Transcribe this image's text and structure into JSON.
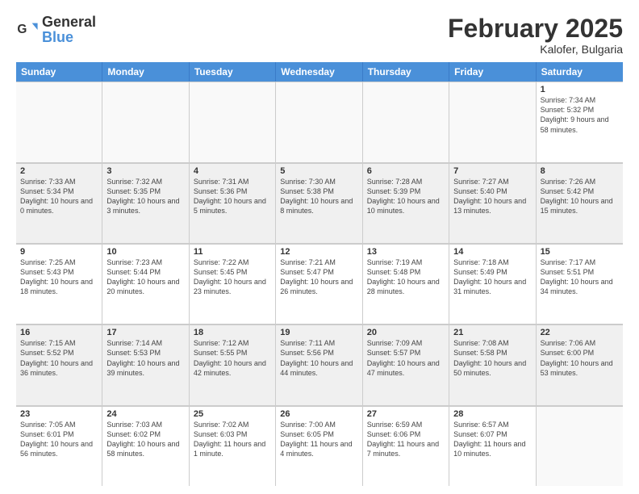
{
  "logo": {
    "general": "General",
    "blue": "Blue"
  },
  "title": "February 2025",
  "location": "Kalofer, Bulgaria",
  "days_of_week": [
    "Sunday",
    "Monday",
    "Tuesday",
    "Wednesday",
    "Thursday",
    "Friday",
    "Saturday"
  ],
  "weeks": [
    [
      {
        "day": "",
        "detail": "",
        "empty": true
      },
      {
        "day": "",
        "detail": "",
        "empty": true
      },
      {
        "day": "",
        "detail": "",
        "empty": true
      },
      {
        "day": "",
        "detail": "",
        "empty": true
      },
      {
        "day": "",
        "detail": "",
        "empty": true
      },
      {
        "day": "",
        "detail": "",
        "empty": true
      },
      {
        "day": "1",
        "detail": "Sunrise: 7:34 AM\nSunset: 5:32 PM\nDaylight: 9 hours and 58 minutes."
      }
    ],
    [
      {
        "day": "2",
        "detail": "Sunrise: 7:33 AM\nSunset: 5:34 PM\nDaylight: 10 hours and 0 minutes.",
        "shaded": true
      },
      {
        "day": "3",
        "detail": "Sunrise: 7:32 AM\nSunset: 5:35 PM\nDaylight: 10 hours and 3 minutes.",
        "shaded": true
      },
      {
        "day": "4",
        "detail": "Sunrise: 7:31 AM\nSunset: 5:36 PM\nDaylight: 10 hours and 5 minutes.",
        "shaded": true
      },
      {
        "day": "5",
        "detail": "Sunrise: 7:30 AM\nSunset: 5:38 PM\nDaylight: 10 hours and 8 minutes.",
        "shaded": true
      },
      {
        "day": "6",
        "detail": "Sunrise: 7:28 AM\nSunset: 5:39 PM\nDaylight: 10 hours and 10 minutes.",
        "shaded": true
      },
      {
        "day": "7",
        "detail": "Sunrise: 7:27 AM\nSunset: 5:40 PM\nDaylight: 10 hours and 13 minutes.",
        "shaded": true
      },
      {
        "day": "8",
        "detail": "Sunrise: 7:26 AM\nSunset: 5:42 PM\nDaylight: 10 hours and 15 minutes.",
        "shaded": true
      }
    ],
    [
      {
        "day": "9",
        "detail": "Sunrise: 7:25 AM\nSunset: 5:43 PM\nDaylight: 10 hours and 18 minutes."
      },
      {
        "day": "10",
        "detail": "Sunrise: 7:23 AM\nSunset: 5:44 PM\nDaylight: 10 hours and 20 minutes."
      },
      {
        "day": "11",
        "detail": "Sunrise: 7:22 AM\nSunset: 5:45 PM\nDaylight: 10 hours and 23 minutes."
      },
      {
        "day": "12",
        "detail": "Sunrise: 7:21 AM\nSunset: 5:47 PM\nDaylight: 10 hours and 26 minutes."
      },
      {
        "day": "13",
        "detail": "Sunrise: 7:19 AM\nSunset: 5:48 PM\nDaylight: 10 hours and 28 minutes."
      },
      {
        "day": "14",
        "detail": "Sunrise: 7:18 AM\nSunset: 5:49 PM\nDaylight: 10 hours and 31 minutes."
      },
      {
        "day": "15",
        "detail": "Sunrise: 7:17 AM\nSunset: 5:51 PM\nDaylight: 10 hours and 34 minutes."
      }
    ],
    [
      {
        "day": "16",
        "detail": "Sunrise: 7:15 AM\nSunset: 5:52 PM\nDaylight: 10 hours and 36 minutes.",
        "shaded": true
      },
      {
        "day": "17",
        "detail": "Sunrise: 7:14 AM\nSunset: 5:53 PM\nDaylight: 10 hours and 39 minutes.",
        "shaded": true
      },
      {
        "day": "18",
        "detail": "Sunrise: 7:12 AM\nSunset: 5:55 PM\nDaylight: 10 hours and 42 minutes.",
        "shaded": true
      },
      {
        "day": "19",
        "detail": "Sunrise: 7:11 AM\nSunset: 5:56 PM\nDaylight: 10 hours and 44 minutes.",
        "shaded": true
      },
      {
        "day": "20",
        "detail": "Sunrise: 7:09 AM\nSunset: 5:57 PM\nDaylight: 10 hours and 47 minutes.",
        "shaded": true
      },
      {
        "day": "21",
        "detail": "Sunrise: 7:08 AM\nSunset: 5:58 PM\nDaylight: 10 hours and 50 minutes.",
        "shaded": true
      },
      {
        "day": "22",
        "detail": "Sunrise: 7:06 AM\nSunset: 6:00 PM\nDaylight: 10 hours and 53 minutes.",
        "shaded": true
      }
    ],
    [
      {
        "day": "23",
        "detail": "Sunrise: 7:05 AM\nSunset: 6:01 PM\nDaylight: 10 hours and 56 minutes."
      },
      {
        "day": "24",
        "detail": "Sunrise: 7:03 AM\nSunset: 6:02 PM\nDaylight: 10 hours and 58 minutes."
      },
      {
        "day": "25",
        "detail": "Sunrise: 7:02 AM\nSunset: 6:03 PM\nDaylight: 11 hours and 1 minute."
      },
      {
        "day": "26",
        "detail": "Sunrise: 7:00 AM\nSunset: 6:05 PM\nDaylight: 11 hours and 4 minutes."
      },
      {
        "day": "27",
        "detail": "Sunrise: 6:59 AM\nSunset: 6:06 PM\nDaylight: 11 hours and 7 minutes."
      },
      {
        "day": "28",
        "detail": "Sunrise: 6:57 AM\nSunset: 6:07 PM\nDaylight: 11 hours and 10 minutes."
      },
      {
        "day": "",
        "detail": "",
        "empty": true
      }
    ]
  ]
}
